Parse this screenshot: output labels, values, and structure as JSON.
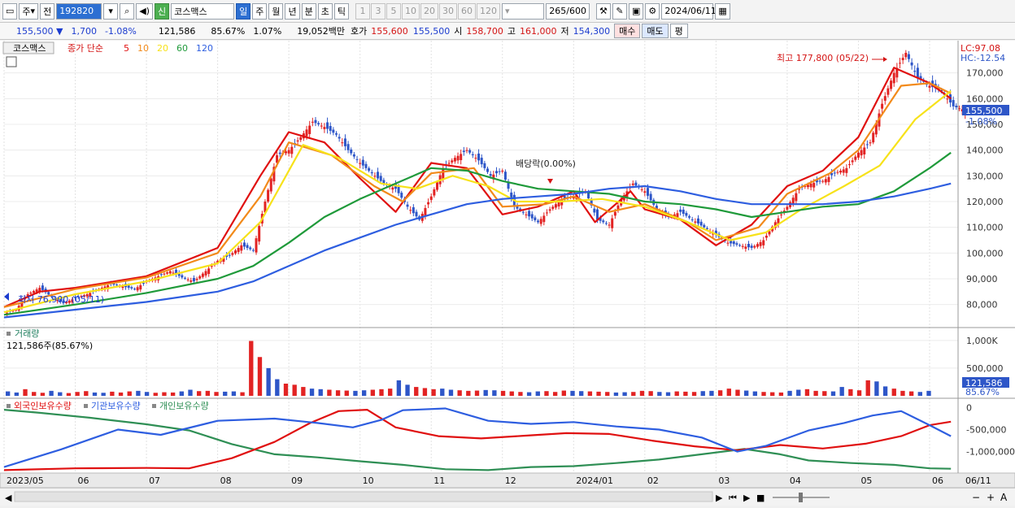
{
  "toolbar": {
    "period": "주",
    "prev": "전",
    "code": "192820",
    "name": "코스맥스",
    "credit_badge": "신",
    "intervals": [
      "일",
      "주",
      "월",
      "년",
      "분",
      "초",
      "틱"
    ],
    "active_interval": "일",
    "minutes": [
      "1",
      "3",
      "5",
      "10",
      "20",
      "30",
      "60",
      "120"
    ],
    "count": "265",
    "count_total": "/600",
    "date": "2024/06/11"
  },
  "quote": {
    "price": "155,500",
    "arrow": "▼",
    "change": "1,700",
    "change_pct": "-1.08%",
    "volume": "121,586",
    "volume_ratio": "85.67%",
    "turnover_rate": "1.07%",
    "amount": "19,052백만",
    "hoga_label": "호가",
    "ask": "155,600",
    "bid": "155,500",
    "open_label": "시",
    "open": "158,700",
    "high_label": "고",
    "high": "161,000",
    "low_label": "저",
    "low": "154,300",
    "buy_label": "매수",
    "sell_label": "매도",
    "avg_label": "평"
  },
  "price_panel": {
    "stock_tag": "코스맥스",
    "legend_ma": "종가 단순",
    "ma_periods": [
      "5",
      "10",
      "20",
      "60",
      "120"
    ],
    "lc_label": "LC:97.08",
    "hc_label": "HC:-12.54",
    "high_annotation": "최고 177,800 (05/22)",
    "low_annotation": "최저 76,900 (05/11)",
    "dividend_annotation": "배당락(0.00%)",
    "price_tag": "155,500",
    "price_tag_pct": "-1.08%",
    "y_ticks": [
      "170,000",
      "160,000",
      "150,000",
      "140,000",
      "130,000",
      "120,000",
      "110,000",
      "100,000",
      "90,000",
      "80,000"
    ]
  },
  "volume_panel": {
    "title": "거래량",
    "current": "121,586주(85.67%)",
    "y_ticks": [
      "1,000K",
      "500,000"
    ],
    "tag_value": "121,586",
    "tag_pct": "85.67%"
  },
  "holding_panel": {
    "legend": [
      "외국인보유수량",
      "기관보유수량",
      "개인보유수량"
    ],
    "y_ticks": [
      "0",
      "-500,000",
      "-1,000,000"
    ]
  },
  "x_axis": {
    "labels": [
      "2023/05",
      "06",
      "07",
      "08",
      "09",
      "10",
      "11",
      "12",
      "2024/01",
      "02",
      "03",
      "04",
      "05",
      "06"
    ],
    "right_label": "06/11"
  },
  "colors": {
    "up": "#e22323",
    "down": "#2e56c8",
    "ma5": "#e01010",
    "ma10": "#f28a1a",
    "ma20": "#f7e21a",
    "ma60": "#1f9a3a",
    "ma120": "#2e5ee0",
    "foreign": "#2e5ee0",
    "institution": "#e01010",
    "individual": "#2f8f55"
  },
  "chart_data": {
    "type": "line",
    "title": "코스맥스",
    "x": [
      "2023/05",
      "06",
      "07",
      "08",
      "09",
      "10",
      "11",
      "12",
      "2024/01",
      "02",
      "03",
      "04",
      "05",
      "06"
    ],
    "ylim": [
      72000,
      180000
    ],
    "close_series": [
      {
        "m": "2023/05",
        "values": [
          78000,
          84000,
          86500,
          83000,
          80500,
          82500
        ]
      },
      {
        "m": "06",
        "values": [
          84000,
          86000,
          88000,
          87000,
          86000,
          89000
        ]
      },
      {
        "m": "07",
        "values": [
          91000,
          93000,
          90500,
          89000,
          93000,
          97000
        ]
      },
      {
        "m": "08",
        "values": [
          99000,
          103000,
          101000,
          120000,
          138000,
          140000
        ]
      },
      {
        "m": "09",
        "values": [
          145000,
          151000,
          149000,
          146000,
          140000,
          135000
        ]
      },
      {
        "m": "10",
        "values": [
          131000,
          127000,
          125000,
          118000,
          113000,
          122000
        ]
      },
      {
        "m": "11",
        "values": [
          133000,
          137000,
          140000,
          136000,
          130000,
          132000
        ]
      },
      {
        "m": "12",
        "values": [
          118000,
          115000,
          112000,
          117000,
          121000,
          122000
        ]
      },
      {
        "m": "2024/01",
        "values": [
          124000,
          113000,
          111000,
          121000,
          127000,
          124000
        ]
      },
      {
        "m": "02",
        "values": [
          117000,
          114000,
          116000,
          113000,
          110000,
          107000
        ]
      },
      {
        "m": "03",
        "values": [
          104000,
          103000,
          102000,
          105000,
          112000,
          118000
        ]
      },
      {
        "m": "04",
        "values": [
          125000,
          127000,
          128000,
          131000,
          133000,
          139000
        ]
      },
      {
        "m": "05",
        "values": [
          143000,
          158000,
          170000,
          177800,
          168000,
          165000
        ]
      },
      {
        "m": "06",
        "values": [
          163000,
          157000,
          155500
        ]
      }
    ],
    "series": [
      {
        "name": "5",
        "anchors": [
          [
            0,
            79000
          ],
          [
            0.5,
            85000
          ],
          [
            1,
            86500
          ],
          [
            2,
            91000
          ],
          [
            3,
            102000
          ],
          [
            3.6,
            130000
          ],
          [
            4,
            147000
          ],
          [
            4.5,
            143000
          ],
          [
            5,
            129000
          ],
          [
            5.5,
            116000
          ],
          [
            6,
            135000
          ],
          [
            6.5,
            133000
          ],
          [
            7,
            115000
          ],
          [
            7.5,
            118000
          ],
          [
            8,
            124000
          ],
          [
            8.3,
            112000
          ],
          [
            8.8,
            124000
          ],
          [
            9,
            117000
          ],
          [
            9.5,
            113000
          ],
          [
            10,
            103000
          ],
          [
            10.5,
            111000
          ],
          [
            11,
            126000
          ],
          [
            11.5,
            132000
          ],
          [
            12,
            145000
          ],
          [
            12.5,
            172000
          ],
          [
            13,
            166000
          ],
          [
            13.3,
            160000
          ]
        ]
      },
      {
        "name": "10",
        "anchors": [
          [
            0,
            79000
          ],
          [
            1,
            86000
          ],
          [
            2,
            90500
          ],
          [
            3,
            100000
          ],
          [
            3.6,
            122000
          ],
          [
            4,
            143000
          ],
          [
            4.6,
            138000
          ],
          [
            5.2,
            126000
          ],
          [
            5.6,
            120000
          ],
          [
            6,
            131000
          ],
          [
            6.6,
            133000
          ],
          [
            7,
            118000
          ],
          [
            7.6,
            119000
          ],
          [
            8,
            122000
          ],
          [
            8.5,
            116000
          ],
          [
            9,
            119000
          ],
          [
            9.6,
            112000
          ],
          [
            10,
            105000
          ],
          [
            10.6,
            110000
          ],
          [
            11,
            123000
          ],
          [
            11.6,
            131000
          ],
          [
            12,
            140000
          ],
          [
            12.6,
            165000
          ],
          [
            13,
            166000
          ],
          [
            13.3,
            162000
          ]
        ]
      },
      {
        "name": "20",
        "anchors": [
          [
            0,
            77000
          ],
          [
            1,
            84000
          ],
          [
            2,
            89000
          ],
          [
            3,
            96000
          ],
          [
            3.6,
            112000
          ],
          [
            4.2,
            142000
          ],
          [
            4.7,
            137000
          ],
          [
            5.3,
            127000
          ],
          [
            5.8,
            125000
          ],
          [
            6.3,
            130000
          ],
          [
            6.8,
            126000
          ],
          [
            7.2,
            120000
          ],
          [
            7.8,
            120000
          ],
          [
            8.4,
            121000
          ],
          [
            9,
            118000
          ],
          [
            9.6,
            112000
          ],
          [
            10.2,
            105000
          ],
          [
            10.7,
            108000
          ],
          [
            11.2,
            117000
          ],
          [
            11.8,
            126000
          ],
          [
            12.3,
            134000
          ],
          [
            12.8,
            152000
          ],
          [
            13.3,
            163000
          ]
        ]
      },
      {
        "name": "60",
        "anchors": [
          [
            0,
            76000
          ],
          [
            1,
            80000
          ],
          [
            2,
            84500
          ],
          [
            3,
            90000
          ],
          [
            3.5,
            95000
          ],
          [
            4,
            104000
          ],
          [
            4.5,
            114000
          ],
          [
            5,
            121000
          ],
          [
            5.5,
            127000
          ],
          [
            6,
            133000
          ],
          [
            6.5,
            132000
          ],
          [
            7,
            128000
          ],
          [
            7.5,
            125000
          ],
          [
            8,
            124000
          ],
          [
            8.5,
            123000
          ],
          [
            9,
            120000
          ],
          [
            9.5,
            119000
          ],
          [
            10,
            117000
          ],
          [
            10.5,
            114000
          ],
          [
            11,
            116000
          ],
          [
            11.5,
            118000
          ],
          [
            12,
            119000
          ],
          [
            12.5,
            124000
          ],
          [
            13,
            133000
          ],
          [
            13.3,
            139000
          ]
        ]
      },
      {
        "name": "120",
        "anchors": [
          [
            0,
            75000
          ],
          [
            1,
            78000
          ],
          [
            2,
            81000
          ],
          [
            3,
            85000
          ],
          [
            3.5,
            89000
          ],
          [
            4,
            95000
          ],
          [
            4.5,
            101000
          ],
          [
            5,
            106000
          ],
          [
            5.5,
            111000
          ],
          [
            6,
            115000
          ],
          [
            6.5,
            119000
          ],
          [
            7,
            121000
          ],
          [
            7.5,
            122000
          ],
          [
            8,
            123000
          ],
          [
            8.5,
            125000
          ],
          [
            9,
            126000
          ],
          [
            9.5,
            124000
          ],
          [
            10,
            121000
          ],
          [
            10.5,
            119000
          ],
          [
            11,
            119000
          ],
          [
            11.5,
            119000
          ],
          [
            12,
            120000
          ],
          [
            12.5,
            122000
          ],
          [
            13,
            125000
          ],
          [
            13.3,
            127000
          ]
        ]
      }
    ],
    "volume_k": [
      80,
      60,
      120,
      70,
      55,
      90,
      65,
      50,
      70,
      85,
      60,
      55,
      75,
      60,
      80,
      90,
      70,
      55,
      65,
      60,
      80,
      110,
      85,
      90,
      70,
      75,
      80,
      65,
      990,
      700,
      500,
      300,
      220,
      200,
      160,
      130,
      120,
      110,
      100,
      95,
      90,
      100,
      110,
      120,
      130,
      280,
      200,
      160,
      140,
      120,
      130,
      110,
      100,
      90,
      95,
      105,
      100,
      90,
      80,
      70,
      65,
      80,
      85,
      70,
      95,
      90,
      85,
      80,
      75,
      70,
      60,
      65,
      70,
      90,
      85,
      70,
      65,
      80,
      75,
      70,
      85,
      90,
      100,
      130,
      110,
      95,
      80,
      70,
      65,
      60,
      90,
      110,
      120,
      90,
      85,
      80,
      160,
      120,
      100,
      280,
      260,
      170,
      130,
      90,
      80,
      70,
      90
    ],
    "holding": {
      "foreign": [
        [
          0,
          -1350000
        ],
        [
          0.8,
          -950000
        ],
        [
          1.6,
          -500000
        ],
        [
          2.2,
          -620000
        ],
        [
          3,
          -300000
        ],
        [
          3.8,
          -250000
        ],
        [
          4.4,
          -350000
        ],
        [
          4.9,
          -450000
        ],
        [
          5.3,
          -280000
        ],
        [
          5.6,
          -60000
        ],
        [
          6.2,
          -20000
        ],
        [
          6.8,
          -300000
        ],
        [
          7.4,
          -370000
        ],
        [
          8,
          -330000
        ],
        [
          8.6,
          -430000
        ],
        [
          9.2,
          -500000
        ],
        [
          9.8,
          -680000
        ],
        [
          10.3,
          -1000000
        ],
        [
          10.7,
          -870000
        ],
        [
          11.3,
          -520000
        ],
        [
          11.8,
          -350000
        ],
        [
          12.2,
          -180000
        ],
        [
          12.6,
          -80000
        ],
        [
          13,
          -400000
        ],
        [
          13.3,
          -650000
        ]
      ],
      "institution": [
        [
          0,
          -1420000
        ],
        [
          1,
          -1380000
        ],
        [
          2,
          -1370000
        ],
        [
          2.6,
          -1380000
        ],
        [
          3.2,
          -1150000
        ],
        [
          3.8,
          -780000
        ],
        [
          4.3,
          -350000
        ],
        [
          4.7,
          -80000
        ],
        [
          5.1,
          -50000
        ],
        [
          5.5,
          -450000
        ],
        [
          6.1,
          -650000
        ],
        [
          6.7,
          -700000
        ],
        [
          7.3,
          -640000
        ],
        [
          7.9,
          -580000
        ],
        [
          8.5,
          -600000
        ],
        [
          9.1,
          -750000
        ],
        [
          9.7,
          -880000
        ],
        [
          10.3,
          -970000
        ],
        [
          10.9,
          -850000
        ],
        [
          11.5,
          -930000
        ],
        [
          12.1,
          -820000
        ],
        [
          12.6,
          -650000
        ],
        [
          13,
          -400000
        ],
        [
          13.3,
          -320000
        ]
      ],
      "individual": [
        [
          0,
          -50000
        ],
        [
          0.5,
          -120000
        ],
        [
          1.2,
          -230000
        ],
        [
          2,
          -380000
        ],
        [
          2.6,
          -520000
        ],
        [
          3.2,
          -830000
        ],
        [
          3.8,
          -1060000
        ],
        [
          4.4,
          -1130000
        ],
        [
          5,
          -1220000
        ],
        [
          5.6,
          -1300000
        ],
        [
          6.2,
          -1400000
        ],
        [
          6.8,
          -1420000
        ],
        [
          7.4,
          -1350000
        ],
        [
          8,
          -1330000
        ],
        [
          8.6,
          -1260000
        ],
        [
          9.2,
          -1180000
        ],
        [
          9.8,
          -1060000
        ],
        [
          10.4,
          -940000
        ],
        [
          10.9,
          -1060000
        ],
        [
          11.3,
          -1200000
        ],
        [
          11.9,
          -1260000
        ],
        [
          12.5,
          -1300000
        ],
        [
          13,
          -1380000
        ],
        [
          13.3,
          -1390000
        ]
      ]
    }
  }
}
